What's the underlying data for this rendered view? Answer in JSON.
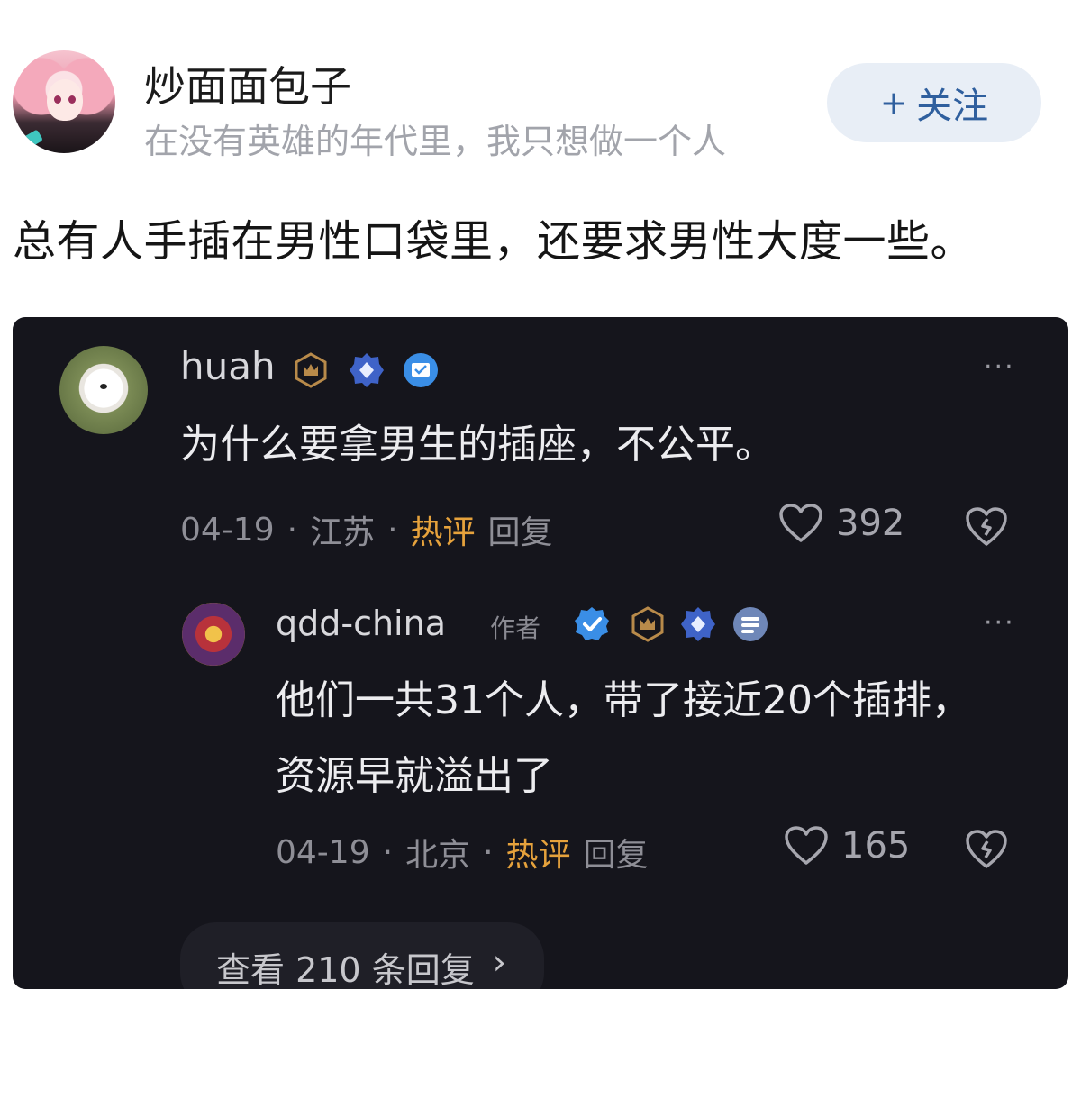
{
  "post": {
    "author_name": "炒面面包子",
    "author_signature": "在没有英雄的年代里，我只想做一个人",
    "follow_label": "关注",
    "follow_prefix": "+",
    "text": "总有人手插在男性口袋里，还要求男性大度一些。"
  },
  "comments": [
    {
      "username": "huah",
      "text_lines": [
        "为什么要拿男生的插座，不公平。"
      ],
      "date": "04-19",
      "location": "江苏",
      "hot_label": "热评",
      "reply_label": "回复",
      "likes": "392"
    },
    {
      "username": "qdd-china",
      "author_tag": "作者",
      "text_lines": [
        "他们一共31个人，带了接近20个插排，",
        "资源早就溢出了"
      ],
      "date": "04-19",
      "location": "北京",
      "hot_label": "热评",
      "reply_label": "回复",
      "likes": "165"
    }
  ],
  "view_replies": {
    "label": "查看 210 条回复",
    "chevron": "›"
  },
  "more_glyph": "···",
  "separator": "·",
  "icons": {
    "crown_badge": "crown-badge-icon",
    "diamond_badge": "diamond-badge-icon",
    "verified_badge": "verified-badge-icon",
    "like": "heart-icon",
    "dislike": "broken-heart-icon",
    "more": "more-dots-icon"
  },
  "colors": {
    "card_bg": "#15151c",
    "hot": "#e6a23c",
    "follow_text": "#2f5f9e",
    "follow_bg": "#e8eef6"
  }
}
